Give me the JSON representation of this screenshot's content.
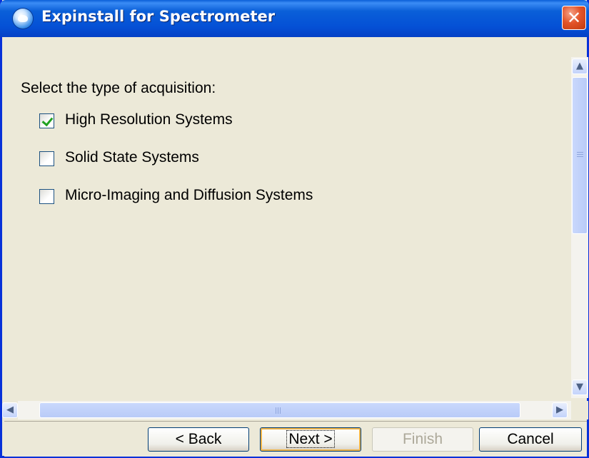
{
  "window": {
    "title": "Expinstall for Spectrometer",
    "close_glyph": "✕"
  },
  "main": {
    "prompt": "Select the type of acquisition:",
    "options": [
      {
        "label": "High Resolution Systems",
        "checked": true
      },
      {
        "label": "Solid State Systems",
        "checked": false
      },
      {
        "label": "Micro-Imaging and Diffusion Systems",
        "checked": false
      }
    ]
  },
  "scrollbars": {
    "up": "▲",
    "down": "▼",
    "left": "◀",
    "right": "▶"
  },
  "buttons": {
    "back": "< Back",
    "next": "Next >",
    "finish": "Finish",
    "cancel": "Cancel",
    "finish_enabled": false,
    "default_button": "next"
  },
  "colors": {
    "titlebar": "#0a5fd8",
    "dialog_bg": "#ece9d8",
    "checkmark": "#21a121"
  }
}
